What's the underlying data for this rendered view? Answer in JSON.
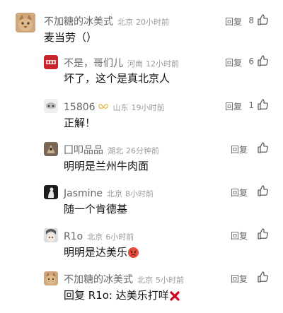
{
  "comments": [
    {
      "name": "不加糖的冰美式",
      "location": "北京",
      "time": "20小时前",
      "text": "麦当劳（）",
      "reply": "回复",
      "likes": "8"
    },
    {
      "name": "不是，哥们儿",
      "location": "河南",
      "time": "12小时前",
      "text": "坏了，这个是真北京人",
      "reply": "回复",
      "likes": "6"
    },
    {
      "name": "15806",
      "location": "山东",
      "time": "19小时前",
      "text": "正解！",
      "reply": "回复",
      "likes": "1"
    },
    {
      "name": "囗叩品品",
      "location": "湖北",
      "time": "26分钟前",
      "text": "明明是兰州牛肉面",
      "reply": "回复",
      "likes": ""
    },
    {
      "name": "Jasmine",
      "location": "北京",
      "time": "8小时前",
      "text": "随一个肯德基",
      "reply": "回复",
      "likes": ""
    },
    {
      "name": "R1o",
      "location": "北京",
      "time": "6小时前",
      "text": "明明是达美乐",
      "reply": "回复",
      "likes": ""
    },
    {
      "name": "不加糖的冰美式",
      "location": "北京",
      "time": "5小时前",
      "text": "回复 R1o: 达美乐打咩",
      "reply": "回复",
      "likes": ""
    }
  ],
  "icons": {
    "like": "thumbs-up-icon",
    "verified": "butterfly-badge-icon",
    "angry": "angry-face-emoji",
    "cross": "red-cross-emoji"
  },
  "colors": {
    "meta": "#9a9a9a",
    "name": "#666666",
    "cross": "#d0021b",
    "angry": "#e74c3c"
  }
}
